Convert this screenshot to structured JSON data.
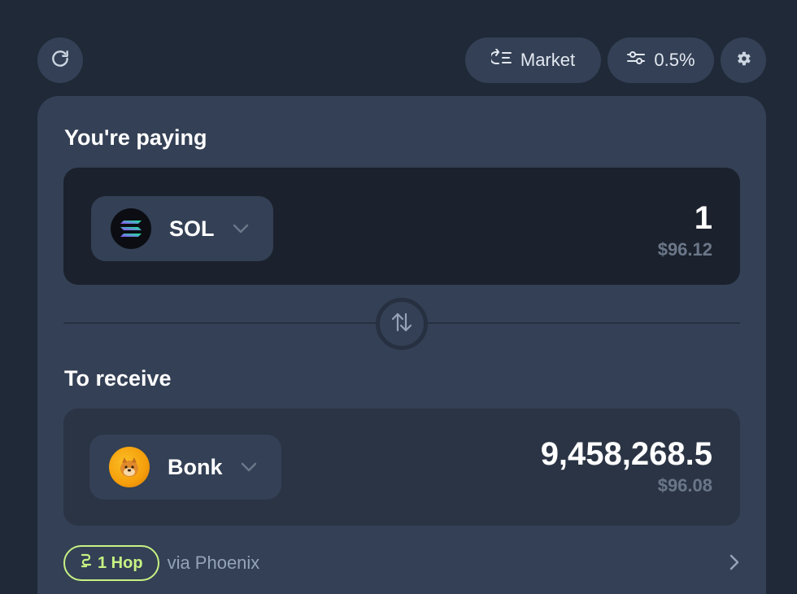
{
  "topbar": {
    "refresh_icon": "refresh-icon",
    "market_label": "Market",
    "slippage_label": "0.5%",
    "settings_icon": "gear-icon"
  },
  "pay": {
    "label": "You're paying",
    "token_symbol": "SOL",
    "amount": "1",
    "usd_value": "$96.12"
  },
  "receive": {
    "label": "To receive",
    "token_symbol": "Bonk",
    "amount": "9,458,268.5",
    "usd_value": "$96.08"
  },
  "route": {
    "hops_label": "1 Hop",
    "via_text": "via Phoenix"
  },
  "colors": {
    "background": "#1f2937",
    "card": "#344055",
    "accent_green": "#c7f284"
  }
}
